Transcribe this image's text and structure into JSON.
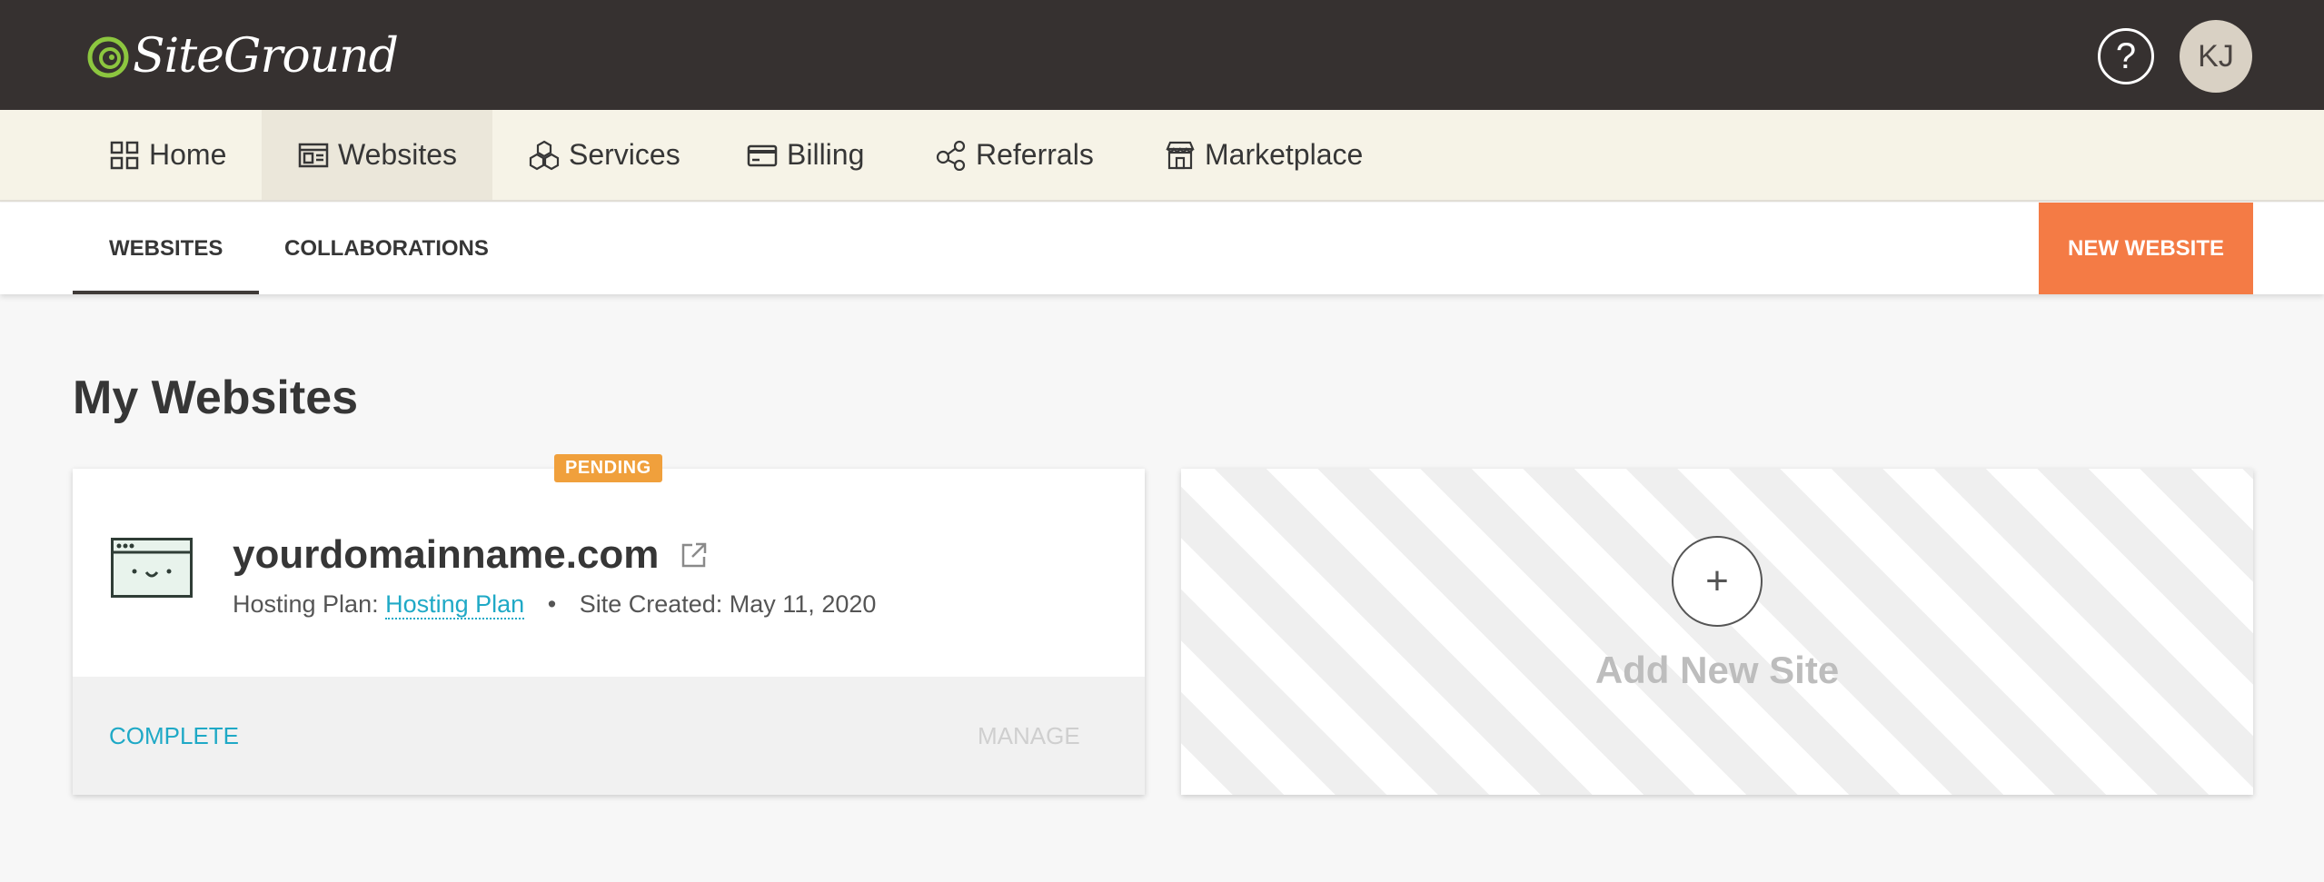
{
  "header": {
    "logo_text": "SiteGround",
    "help_symbol": "?",
    "avatar_initials": "KJ"
  },
  "nav": {
    "items": [
      {
        "label": "Home",
        "icon": "grid-icon"
      },
      {
        "label": "Websites",
        "icon": "browser-window-icon"
      },
      {
        "label": "Services",
        "icon": "cubes-icon"
      },
      {
        "label": "Billing",
        "icon": "credit-card-icon"
      },
      {
        "label": "Referrals",
        "icon": "share-icon"
      },
      {
        "label": "Marketplace",
        "icon": "storefront-icon"
      }
    ],
    "active": "Websites"
  },
  "subtabs": {
    "items": [
      "WEBSITES",
      "COLLABORATIONS"
    ],
    "active": "WEBSITES",
    "new_website_label": "NEW WEBSITE"
  },
  "page": {
    "title": "My Websites"
  },
  "site_card": {
    "badge": "PENDING",
    "domain": "yourdomainname.com",
    "hosting_plan_prefix": "Hosting Plan:",
    "hosting_plan_link": "Hosting Plan",
    "separator": "•",
    "created": "Site Created: May 11, 2020",
    "complete_label": "COMPLETE",
    "manage_label": "MANAGE"
  },
  "add_card": {
    "plus": "+",
    "label": "Add New Site"
  },
  "colors": {
    "topbar": "#363130",
    "nav_bg": "#f6f3e7",
    "accent_orange": "#f47b45",
    "badge_orange": "#f0a03c",
    "link_teal": "#1fa9c6",
    "logo_green": "#8cc63f"
  }
}
